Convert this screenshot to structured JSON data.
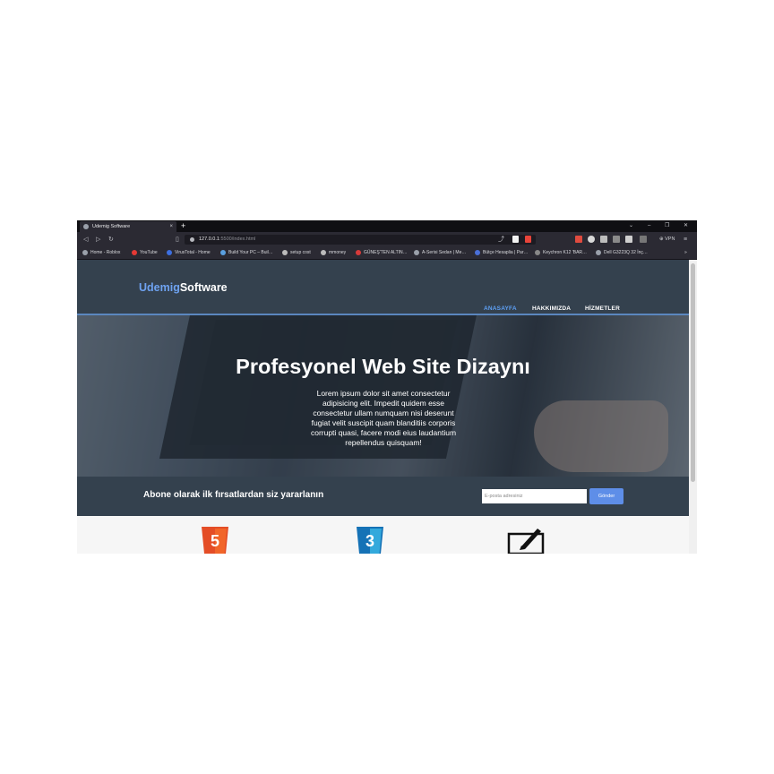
{
  "browser": {
    "tab_title": "Udemig Software",
    "tab_close": "×",
    "new_tab": "+",
    "window_controls": [
      "⌄",
      "–",
      "❐",
      "✕"
    ],
    "url_host": "127.0.0.1",
    "url_rest": ":5500/index.html",
    "vpn_label": "⊕ VPN",
    "bookmarks": [
      "Home - Roblox",
      "YouTube",
      "VirusTotal - Home",
      "Build Your PC – Buil…",
      "setup cost",
      "mmoney",
      "GÜNEŞ'TEN ALTIN…",
      "A-Serisi Sedan | Me…",
      "Bütçe Hesaplia | Par…",
      "Keychron K12 'BAR…",
      "Dell G3223Q 32 İnç…"
    ],
    "bookmark_colors": [
      "#9aa0aa",
      "#e53935",
      "#3d6fe0",
      "#5aa0e0",
      "#bbbbbb",
      "#bbbbbb",
      "#d83a3a",
      "#9aa0aa",
      "#4a6fd8",
      "#888888",
      "#9aa0aa"
    ]
  },
  "site": {
    "logo_part1": "Udemig",
    "logo_part2": "Software",
    "nav": [
      "ANASAYFA",
      "HAKKIMIZDA",
      "HİZMETLER"
    ],
    "hero_title": "Profesyonel Web Site Dizaynı",
    "hero_text": "Lorem ipsum dolor sit amet consectetur adipisicing elit. Impedit quidem esse consectetur ullam numquam nisi deserunt fugiat velit suscipit quam blanditiis corporis corrupti quasi, facere modi eius laudantium repellendus quisquam!",
    "subscribe_title": "Abone olarak ilk fırsatlardan siz yararlanın",
    "email_placeholder": "E-posta adresiniz",
    "send_label": "Gönder",
    "feature_icons": [
      "html5-icon",
      "css3-icon",
      "design-icon"
    ],
    "feature_labels": [
      "5",
      "3"
    ]
  },
  "colors": {
    "accent": "#5ea0f5",
    "header_bg": "#34414e",
    "button_bg": "#5e8ee8",
    "html5": "#e44d26",
    "css3": "#1572b6"
  }
}
